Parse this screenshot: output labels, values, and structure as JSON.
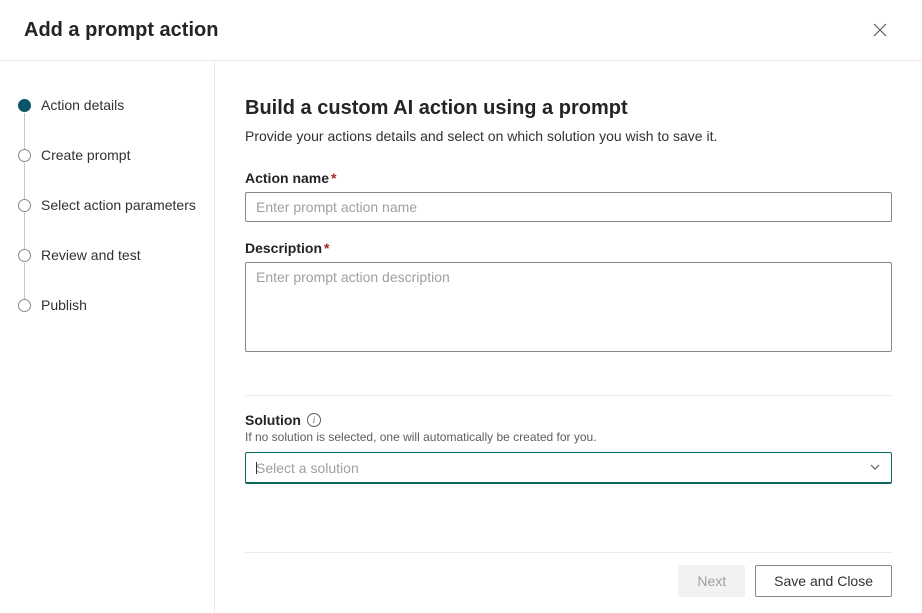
{
  "header": {
    "title": "Add a prompt action"
  },
  "steps": [
    {
      "label": "Action details",
      "active": true
    },
    {
      "label": "Create prompt",
      "active": false
    },
    {
      "label": "Select action parameters",
      "active": false
    },
    {
      "label": "Review and test",
      "active": false
    },
    {
      "label": "Publish",
      "active": false
    }
  ],
  "main": {
    "heading": "Build a custom AI action using a prompt",
    "subtitle": "Provide your actions details and select on which solution you wish to save it.",
    "action_name_label": "Action name",
    "action_name_placeholder": "Enter prompt action name",
    "action_name_value": "",
    "description_label": "Description",
    "description_placeholder": "Enter prompt action description",
    "description_value": "",
    "solution_label": "Solution",
    "solution_helper": "If no solution is selected, one will automatically be created for you.",
    "solution_placeholder": "Select a solution",
    "solution_value": ""
  },
  "footer": {
    "next_label": "Next",
    "save_close_label": "Save and Close"
  }
}
